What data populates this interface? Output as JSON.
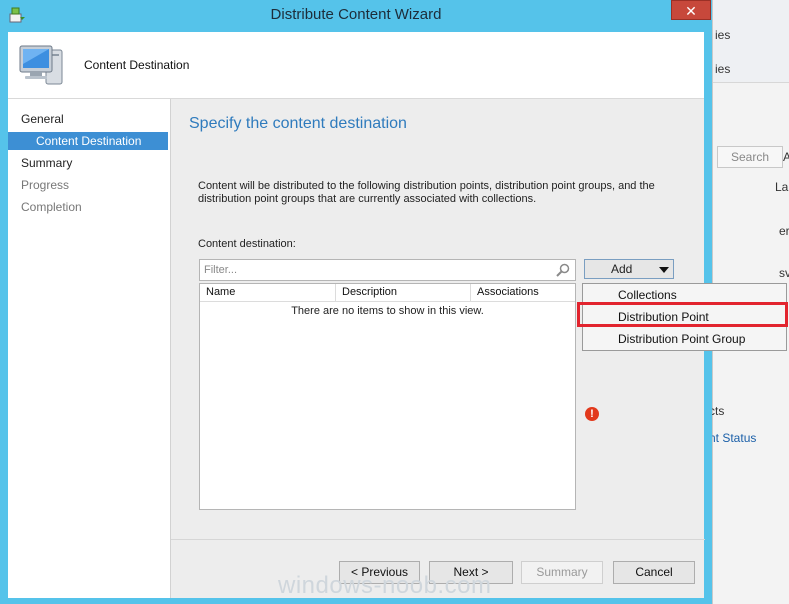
{
  "background_window": {
    "texts": [
      "ies",
      "ies",
      "Search",
      "A",
      "La",
      "er",
      "sv",
      "cts",
      "nt Status"
    ]
  },
  "window": {
    "title": "Distribute Content Wizard",
    "close_label": "✕"
  },
  "header": {
    "label": "Content Destination"
  },
  "nav": {
    "items": [
      {
        "label": "General",
        "state": "normal"
      },
      {
        "label": "Content Destination",
        "state": "selected"
      },
      {
        "label": "Summary",
        "state": "normal"
      },
      {
        "label": "Progress",
        "state": "disabled"
      },
      {
        "label": "Completion",
        "state": "disabled"
      }
    ]
  },
  "main": {
    "title": "Specify the content destination",
    "description": "Content will be distributed to the following distribution points, distribution point groups, and the distribution point groups that are currently associated with collections.",
    "destination_label": "Content destination:",
    "filter_placeholder": "Filter...",
    "columns": [
      "Name",
      "Description",
      "Associations"
    ],
    "empty_message": "There are no items to show in this view.",
    "add_label": "Add",
    "error_symbol": "!"
  },
  "add_menu": {
    "items": [
      "Collections",
      "Distribution Point",
      "Distribution Point Group"
    ],
    "highlighted": "Distribution Point"
  },
  "footer": {
    "previous": "< Previous",
    "next": "Next >",
    "summary": "Summary",
    "cancel": "Cancel"
  },
  "watermark": "windows-noob.com",
  "colors": {
    "frame": "#55c3ea",
    "accent_blue": "#2f7bbd",
    "nav_selected": "#3d8fd4",
    "highlight_red": "#e2242e",
    "error_red": "#e2391c"
  }
}
